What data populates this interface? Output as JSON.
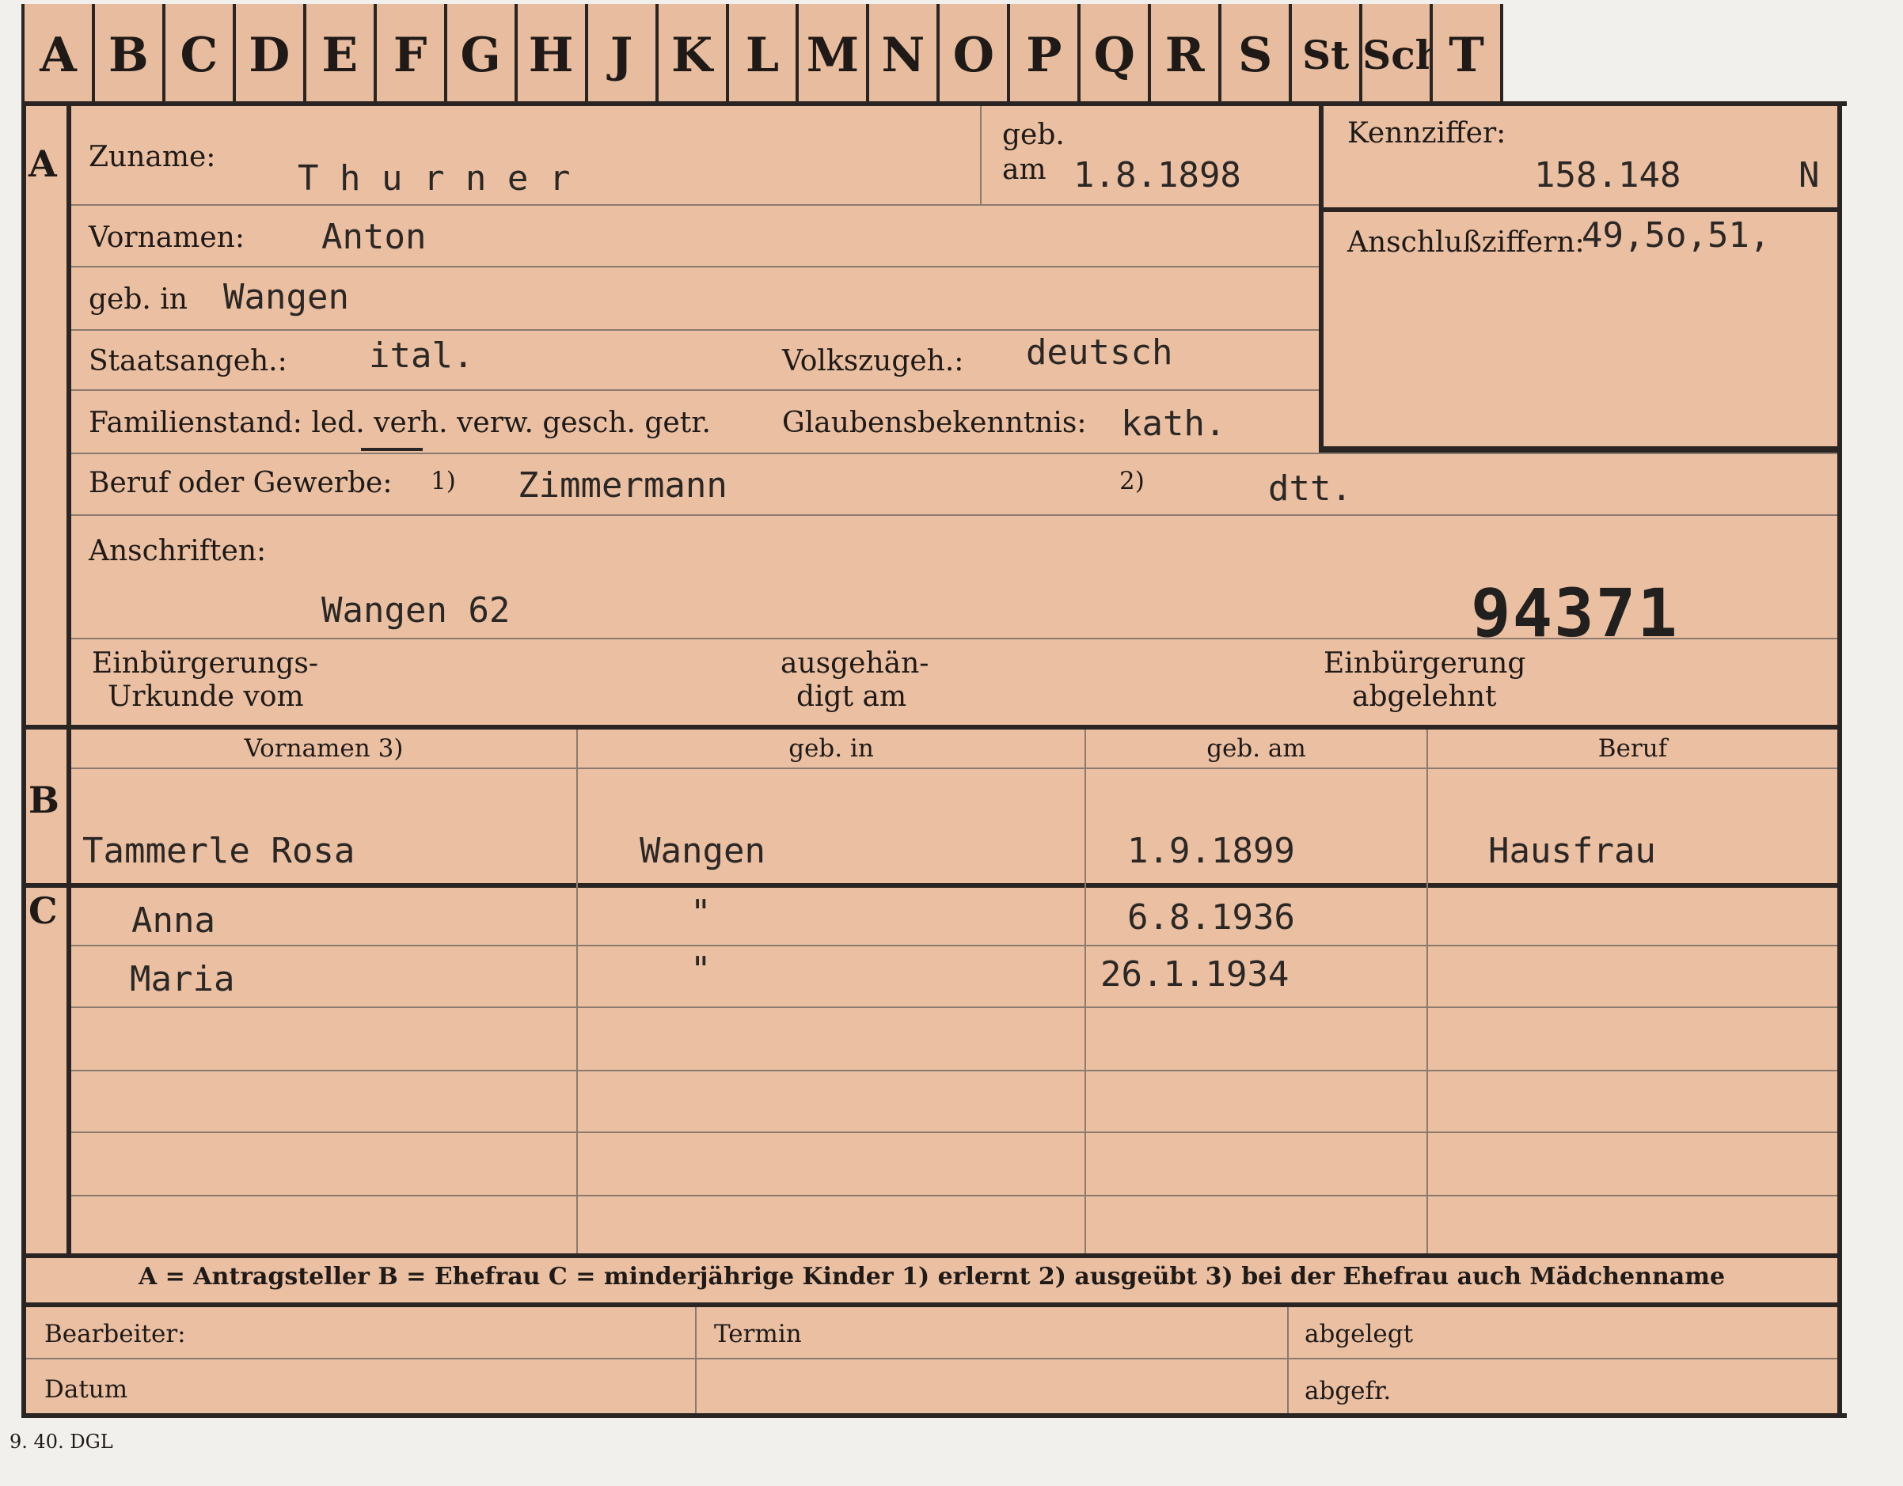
{
  "alphabet_tabs": [
    "A",
    "B",
    "C",
    "D",
    "E",
    "F",
    "G",
    "H",
    "J",
    "K",
    "L",
    "M",
    "N",
    "O",
    "P",
    "Q",
    "R",
    "S",
    "St",
    "Sch",
    "T"
  ],
  "sections": {
    "a": "A",
    "b": "B",
    "c": "C"
  },
  "personal": {
    "zuname_label": "Zuname:",
    "zuname_value": "T h u r n e r",
    "geb_label": "geb.",
    "am_label": "am",
    "geb_am_value": "1.8.1898",
    "vornamen_label": "Vornamen:",
    "vornamen_value": "Anton",
    "geb_in_label": "geb. in",
    "geb_in_value": "Wangen",
    "staatsangeh_label": "Staatsangeh.:",
    "staatsangeh_value": "ital.",
    "volkszugeh_label": "Volkszugeh.:",
    "volkszugeh_value": "deutsch",
    "familienstand_label": "Familienstand: led. verh. verw. gesch. getr.",
    "glaubens_label": "Glaubensbekenntnis:",
    "glaubens_value": "kath.",
    "beruf_label": "Beruf oder Gewerbe:",
    "beruf_mark1": "1)",
    "beruf_value1": "Zimmermann",
    "beruf_mark2": "2)",
    "beruf_value2": "dtt.",
    "anschriften_label": "Anschriften:",
    "anschrift_value": "Wangen   62",
    "stamp_number": "94371",
    "einb_urkunde_label_1": "Einbürgerungs-",
    "einb_urkunde_label_2": "Urkunde vom",
    "ausgehaend_label_1": "ausgehän-",
    "ausgehaend_label_2": "digt am",
    "einb_abgelehnt_label_1": "Einbürgerung",
    "einb_abgelehnt_label_2": "abgelehnt"
  },
  "kennziffer": {
    "label": "Kennziffer:",
    "value": "158.148",
    "suffix": "N",
    "anschluss_label": "Anschlußziffern:",
    "anschluss_value": "49,5o,51,"
  },
  "table": {
    "headers": [
      "Vornamen 3)",
      "geb. in",
      "geb. am",
      "Beruf"
    ],
    "spouse": {
      "name": "Tammerle   Rosa",
      "place": "Wangen",
      "date": "1.9.1899",
      "occupation": "Hausfrau"
    },
    "children": [
      {
        "name": "Anna",
        "place": "\"",
        "date": "6.8.1936",
        "occupation": ""
      },
      {
        "name": "Maria",
        "place": "\"",
        "date": "26.1.1934",
        "occupation": ""
      }
    ]
  },
  "legend": "A = Antragsteller   B = Ehefrau   C = minderjährige Kinder   1) erlernt   2) ausgeübt   3) bei der Ehefrau auch Mädchenname",
  "footer": {
    "bearbeiter": "Bearbeiter:",
    "datum": "Datum",
    "termin": "Termin",
    "abgelegt": "abgelegt",
    "abgefr": "abgefr.",
    "print_code": "9. 40. DGL"
  }
}
